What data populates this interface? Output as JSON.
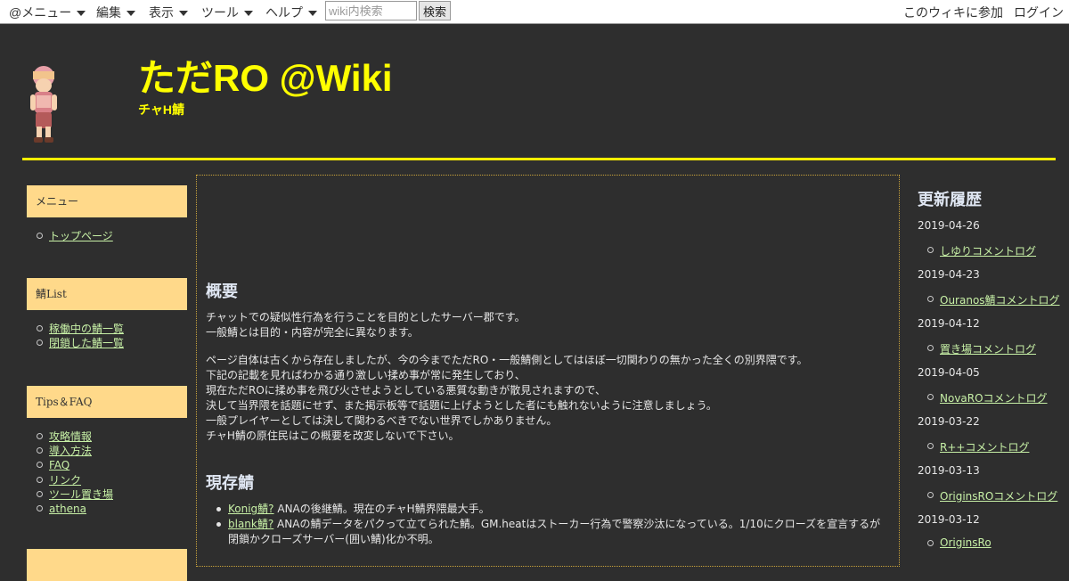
{
  "topbar": {
    "menus": [
      "@メニュー",
      "編集",
      "表示",
      "ツール",
      "ヘルプ"
    ],
    "search_placeholder": "wiki内検索",
    "search_button": "検索",
    "join": "このウィキに参加",
    "login": "ログイン"
  },
  "header": {
    "title": "ただRO @Wiki",
    "subtitle": "チャH鯖"
  },
  "sidebar": {
    "menu_title": "メニュー",
    "menu_items": [
      "トップページ"
    ],
    "servers_title": "鯖List",
    "servers_items": [
      "稼働中の鯖一覧",
      "閉鎖した鯖一覧"
    ],
    "tips_title": "Tips＆FAQ",
    "tips_items": [
      "攻略情報",
      "導入方法",
      "FAQ",
      "リンク",
      "ツール置き場",
      "athena"
    ]
  },
  "main": {
    "overview_heading": "概要",
    "overview_p1": [
      "チャットでの疑似性行為を行うことを目的としたサーバー郡です。",
      "一般鯖とは目的・内容が完全に異なります。"
    ],
    "overview_p2": [
      "ページ自体は古くから存在しましたが、今の今までただRO・一般鯖側としてはほぼ一切関わりの無かった全くの別界隈です。",
      "下記の記載を見ればわかる通り激しい揉め事が常に発生しており、",
      "現在ただROに揉め事を飛び火させようとしている悪質な動きが散見されますので、",
      "決して当界隈を話題にせず、また掲示板等で話題に上げようとした者にも触れないように注意しましょう。",
      "一般プレイヤーとしては決して関わるべきでない世界でしかありません。",
      "チャH鯖の原住民はこの概要を改変しないで下さい。"
    ],
    "current_heading": "現存鯖",
    "servers": [
      {
        "link": "Konig鯖?",
        "text": " ANAの後継鯖。現在のチャH鯖界隈最大手。"
      },
      {
        "link": "blank鯖?",
        "text": " ANAの鯖データをパクって立てられた鯖。GM.heatはストーカー行為で警察沙汰になっている。1/10にクローズを宣言するが閉鎖かクローズサーバー(囲い鯖)化か不明。"
      }
    ]
  },
  "updates": {
    "title": "更新履歴",
    "entries": [
      {
        "date": "2019-04-26",
        "link": "しゆりコメントログ"
      },
      {
        "date": "2019-04-23",
        "link": "Ouranos鯖コメントログ"
      },
      {
        "date": "2019-04-12",
        "link": "置き場コメントログ"
      },
      {
        "date": "2019-04-05",
        "link": "NovaROコメントログ"
      },
      {
        "date": "2019-03-22",
        "link": "R++コメントログ"
      },
      {
        "date": "2019-03-13",
        "link": "OriginsROコメントログ"
      },
      {
        "date": "2019-03-12",
        "link": "OriginsRo"
      }
    ]
  },
  "colors": {
    "background": "#2e2e2e",
    "title_yellow": "#ffff00",
    "menu_header": "#ffd98a",
    "link_green": "#c7f0a6"
  }
}
